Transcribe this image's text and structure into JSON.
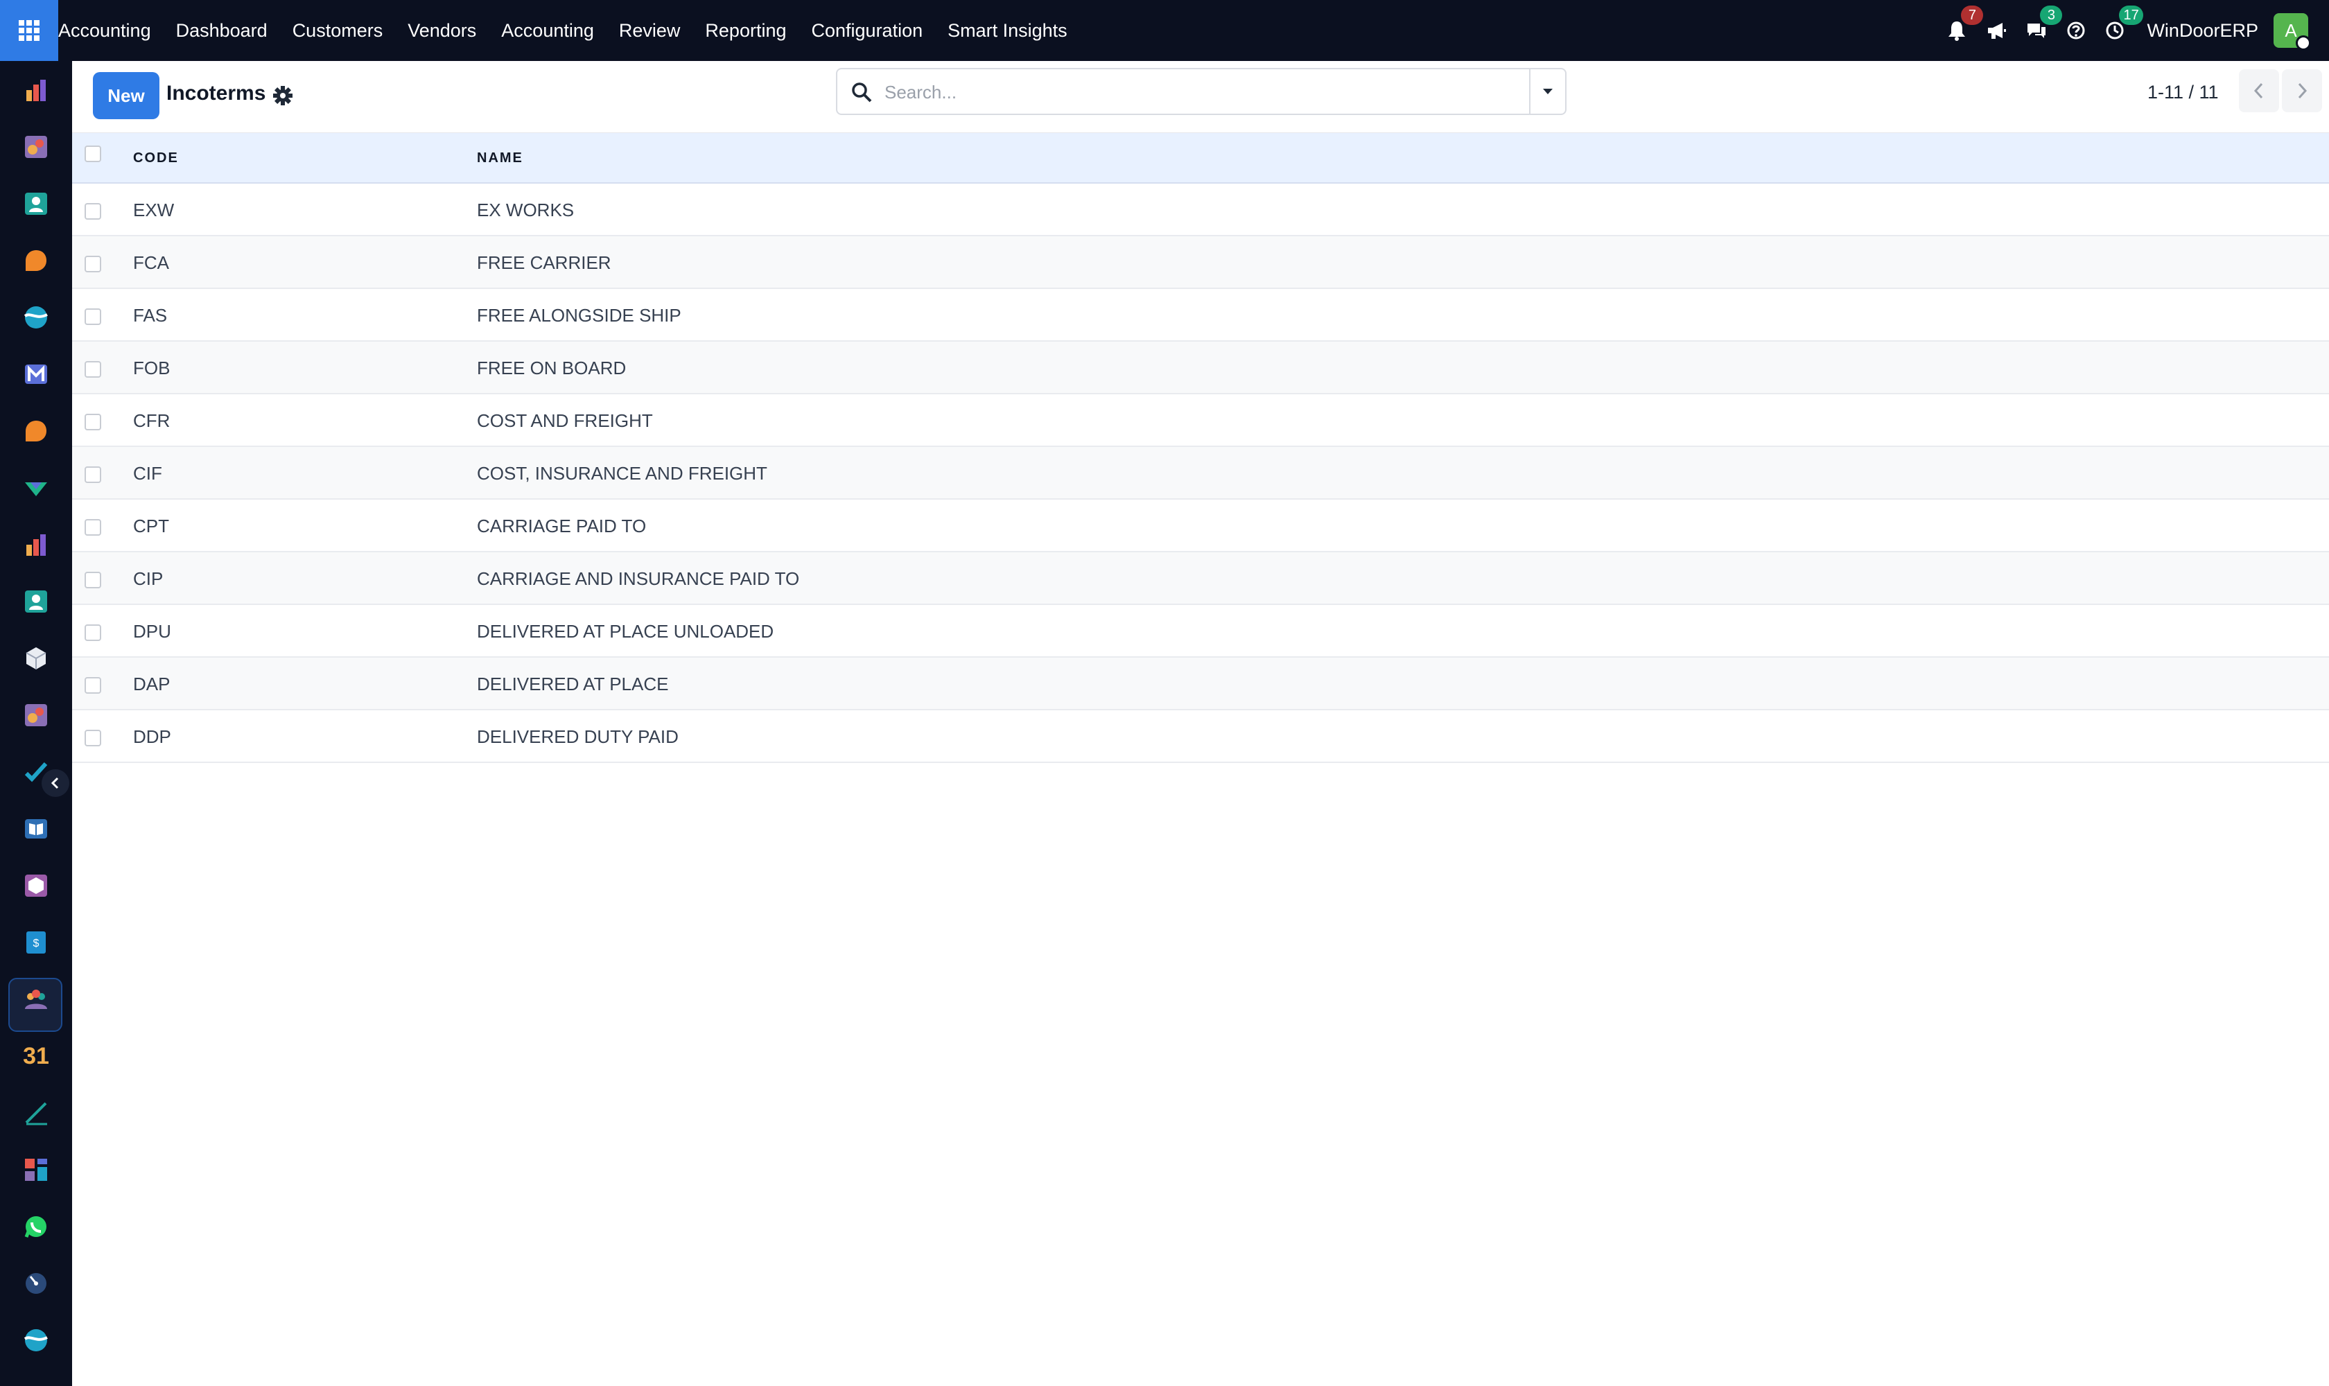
{
  "navbar": {
    "app_name": "Accounting",
    "menu": [
      "Dashboard",
      "Customers",
      "Vendors",
      "Accounting",
      "Review",
      "Reporting",
      "Configuration",
      "Smart Insights"
    ],
    "notifications_count": "7",
    "messages_count": "3",
    "activities_count": "17",
    "company": "WinDoorERP",
    "avatar_initial": "A",
    "colors": {
      "background": "#0b1020",
      "accent": "#2f7be5",
      "notif_badge": "#c0392b",
      "count_badge": "#17a673"
    }
  },
  "control_panel": {
    "new_label": "New",
    "title": "Incoterms",
    "search_placeholder": "Search...",
    "pager": "1-11 / 11"
  },
  "list": {
    "columns": [
      "CODE",
      "NAME"
    ],
    "rows": [
      {
        "code": "EXW",
        "name": "EX WORKS"
      },
      {
        "code": "FCA",
        "name": "FREE CARRIER"
      },
      {
        "code": "FAS",
        "name": "FREE ALONGSIDE SHIP"
      },
      {
        "code": "FOB",
        "name": "FREE ON BOARD"
      },
      {
        "code": "CFR",
        "name": "COST AND FREIGHT"
      },
      {
        "code": "CIF",
        "name": "COST, INSURANCE AND FREIGHT"
      },
      {
        "code": "CPT",
        "name": "CARRIAGE PAID TO"
      },
      {
        "code": "CIP",
        "name": "CARRIAGE AND INSURANCE PAID TO"
      },
      {
        "code": "DPU",
        "name": "DELIVERED AT PLACE UNLOADED"
      },
      {
        "code": "DAP",
        "name": "DELIVERED AT PLACE"
      },
      {
        "code": "DDP",
        "name": "DELIVERED DUTY PAID"
      }
    ]
  },
  "sidebar": {
    "apps": [
      "reporting-app-icon",
      "sales-app-icon",
      "contacts-app-icon",
      "discuss-app-icon",
      "wave-app-icon",
      "mail-app-icon",
      "chat-app-icon",
      "vendor-app-icon",
      "dashboard-app-icon",
      "employees-app-icon",
      "inventory-app-icon",
      "pos-app-icon",
      "project-app-icon",
      "knowledge-app-icon",
      "product-app-icon",
      "invoicing-app-icon",
      "team-app-icon",
      "calendar-app-icon",
      "sign-app-icon",
      "widgets-app-icon",
      "whatsapp-app-icon",
      "timer-app-icon",
      "website-app-icon"
    ],
    "calendar_text": "31"
  }
}
